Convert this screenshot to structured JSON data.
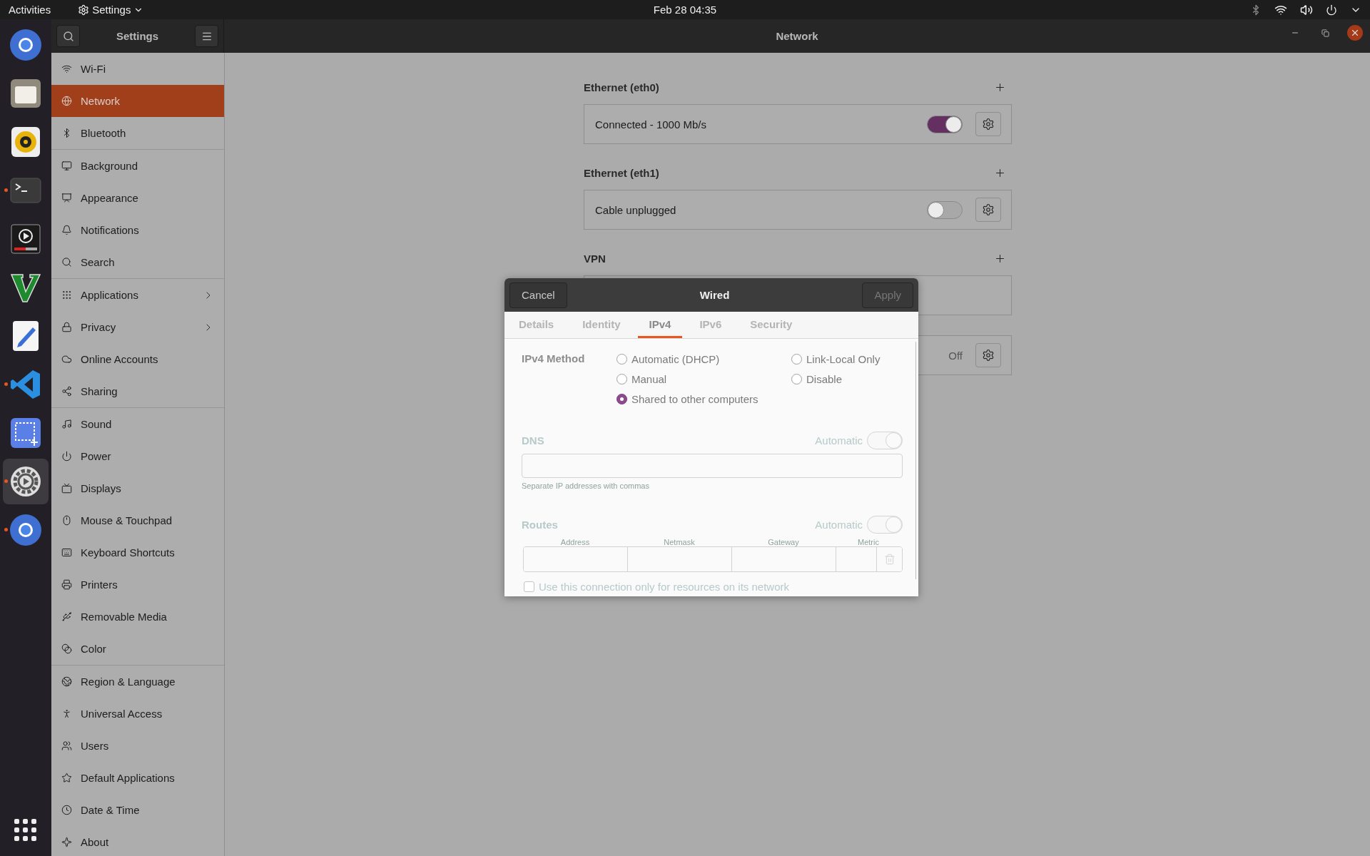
{
  "topbar": {
    "activities": "Activities",
    "app_menu": "Settings",
    "clock": "Feb 28  04:35"
  },
  "dock": {
    "items": [
      {
        "kind": "browser",
        "running": false,
        "selected": false
      },
      {
        "kind": "folder",
        "running": false,
        "selected": false
      },
      {
        "kind": "speaker",
        "running": false,
        "selected": false
      },
      {
        "kind": "terminal",
        "running": true,
        "selected": false
      },
      {
        "kind": "media",
        "running": false,
        "selected": false
      },
      {
        "kind": "vlogo",
        "running": false,
        "selected": false
      },
      {
        "kind": "editor",
        "running": false,
        "selected": false
      },
      {
        "kind": "code",
        "running": true,
        "selected": false
      },
      {
        "kind": "screenshot",
        "running": false,
        "selected": false
      },
      {
        "kind": "gear",
        "running": true,
        "selected": true
      },
      {
        "kind": "browser",
        "running": true,
        "selected": false
      }
    ]
  },
  "headerbar": {
    "sidebar_title": "Settings",
    "title": "Network"
  },
  "sidebar": {
    "groups": [
      [
        {
          "label": "Wi-Fi",
          "kind": "wifi",
          "selected": false,
          "arrow": false
        },
        {
          "label": "Network",
          "kind": "globe",
          "selected": true,
          "arrow": false
        },
        {
          "label": "Bluetooth",
          "kind": "bluetooth",
          "selected": false,
          "arrow": false
        }
      ],
      [
        {
          "label": "Background",
          "kind": "monitor",
          "selected": false,
          "arrow": false
        },
        {
          "label": "Appearance",
          "kind": "presentation",
          "selected": false,
          "arrow": false
        },
        {
          "label": "Notifications",
          "kind": "bell",
          "selected": false,
          "arrow": false
        },
        {
          "label": "Search",
          "kind": "search",
          "selected": false,
          "arrow": false
        }
      ],
      [
        {
          "label": "Applications",
          "kind": "grid",
          "selected": false,
          "arrow": true
        },
        {
          "label": "Privacy",
          "kind": "lock",
          "selected": false,
          "arrow": true
        },
        {
          "label": "Online Accounts",
          "kind": "cloud",
          "selected": false,
          "arrow": false
        },
        {
          "label": "Sharing",
          "kind": "share",
          "selected": false,
          "arrow": false
        }
      ],
      [
        {
          "label": "Sound",
          "kind": "music",
          "selected": false,
          "arrow": false
        },
        {
          "label": "Power",
          "kind": "power",
          "selected": false,
          "arrow": false
        },
        {
          "label": "Displays",
          "kind": "tv",
          "selected": false,
          "arrow": false
        },
        {
          "label": "Mouse & Touchpad",
          "kind": "mouse",
          "selected": false,
          "arrow": false
        },
        {
          "label": "Keyboard Shortcuts",
          "kind": "keyboard",
          "selected": false,
          "arrow": false
        },
        {
          "label": "Printers",
          "kind": "printer",
          "selected": false,
          "arrow": false
        },
        {
          "label": "Removable Media",
          "kind": "usb",
          "selected": false,
          "arrow": false
        },
        {
          "label": "Color",
          "kind": "circles",
          "selected": false,
          "arrow": false
        }
      ],
      [
        {
          "label": "Region & Language",
          "kind": "earth",
          "selected": false,
          "arrow": false
        },
        {
          "label": "Universal Access",
          "kind": "person",
          "selected": false,
          "arrow": false
        },
        {
          "label": "Users",
          "kind": "users",
          "selected": false,
          "arrow": false
        },
        {
          "label": "Default Applications",
          "kind": "star",
          "selected": false,
          "arrow": false
        },
        {
          "label": "Date & Time",
          "kind": "clock",
          "selected": false,
          "arrow": false
        },
        {
          "label": "About",
          "kind": "sparkle",
          "selected": false,
          "arrow": false
        }
      ]
    ]
  },
  "sections": [
    {
      "title": "Ethernet (eth0)",
      "cards": [
        {
          "kind": "device",
          "label": "Connected - 1000 Mb/s",
          "on": true
        }
      ]
    },
    {
      "title": "Ethernet (eth1)",
      "cards": [
        {
          "kind": "device",
          "label": "Cable unplugged",
          "on": false
        }
      ]
    },
    {
      "title": "VPN",
      "cards": [
        {
          "kind": "empty"
        }
      ]
    },
    {
      "cards": [
        {
          "kind": "status",
          "value": "Off"
        }
      ]
    }
  ],
  "dialog": {
    "cancel": "Cancel",
    "title": "Wired",
    "apply": "Apply",
    "apply_disabled": true,
    "tabs": [
      {
        "label": "Details",
        "selected": false
      },
      {
        "label": "Identity",
        "selected": false
      },
      {
        "label": "IPv4",
        "selected": true
      },
      {
        "label": "IPv6",
        "selected": false
      },
      {
        "label": "Security",
        "selected": false
      }
    ],
    "method_label": "IPv4 Method",
    "methods": [
      {
        "label": "Automatic (DHCP)",
        "selected": false
      },
      {
        "label": "Link-Local Only",
        "selected": false
      },
      {
        "label": "Manual",
        "selected": false
      },
      {
        "label": "Disable",
        "selected": false
      },
      {
        "label": "Shared to other computers",
        "selected": true
      }
    ],
    "dns": {
      "label": "DNS",
      "automatic_label": "Automatic",
      "automatic_on": true,
      "hint": "Separate IP addresses with commas"
    },
    "routes": {
      "label": "Routes",
      "automatic_label": "Automatic",
      "automatic_on": true,
      "columns": [
        "Address",
        "Netmask",
        "Gateway",
        "Metric"
      ]
    },
    "only_local": {
      "label": "Use this connection only for resources on its network",
      "checked": false
    }
  }
}
